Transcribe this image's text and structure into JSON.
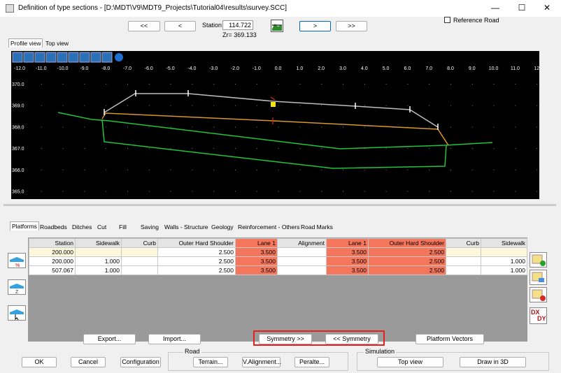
{
  "window": {
    "title": "Definition of type sections - [D:\\MDT\\V9\\MDT9_Projects\\Tutorial04\\results\\survey.SCC]",
    "minimize": "—",
    "maximize": "☐",
    "close": "✕"
  },
  "nav": {
    "first": "<<",
    "prev": "<",
    "next": ">",
    "last": ">>",
    "station_label": "Station",
    "station_value": "114.722",
    "zr": "Zr= 369.133",
    "reference_road": "Reference Road"
  },
  "view_tabs": [
    "Profile view",
    "Top view"
  ],
  "x_ticks": [
    "-12.0",
    "-11.0",
    "-10.0",
    "-9.0",
    "-8.0",
    "-7.0",
    "-6.0",
    "-5.0",
    "-4.0",
    "-3.0",
    "-2.0",
    "-1.0",
    "0.0",
    "1.0",
    "2.0",
    "3.0",
    "4.0",
    "5.0",
    "6.0",
    "7.0",
    "8.0",
    "9.0",
    "10.0",
    "11.0",
    "12"
  ],
  "y_ticks": [
    "370.0",
    "369.0",
    "368.0",
    "367.0",
    "366.0",
    "365.0"
  ],
  "section_tabs": [
    "Platforms",
    "Roadbeds",
    "Ditches",
    "Cut",
    "Fill",
    "Saving",
    "Walls - Structure",
    "Geology",
    "Reinforcement - Others",
    "Road Marks"
  ],
  "table": {
    "headers": [
      "Station",
      "Sidewalk",
      "Curb",
      "Outer Hard Shoulder",
      "Lane 1",
      "Alignment",
      "Lane 1",
      "Outer Hard Shoulder",
      "Curb",
      "Sidewalk"
    ],
    "rows": [
      [
        "200.000",
        "",
        "",
        "2.500",
        "3.500",
        "",
        "3.500",
        "2.500",
        "",
        ""
      ],
      [
        "200.000",
        "1.000",
        "",
        "2.500",
        "3.500",
        "",
        "3.500",
        "2.500",
        "",
        "1.000"
      ],
      [
        "507.067",
        "1.000",
        "",
        "2.500",
        "3.500",
        "",
        "3.500",
        "2.500",
        "",
        "1.000"
      ]
    ]
  },
  "dxdy": {
    "dx": "DX",
    "dy": "DY"
  },
  "buttons": {
    "export": "Export...",
    "import": "Import...",
    "symmetry_right": "Symmetry >>",
    "symmetry_left": "<< Symmetry",
    "platform_vectors": "Platform Vectors",
    "ok": "OK",
    "cancel": "Cancel",
    "configuration": "Configuration",
    "terrain": "Terrain...",
    "valignment": "V.Alignment...",
    "peralte": "Peralte...",
    "top_view": "Top view",
    "draw3d": "Draw in 3D"
  },
  "groups": {
    "road": "Road",
    "simulation": "Simulation"
  },
  "colors": {
    "canvas_bg": "#000000",
    "highlight_cell": "#f4765d",
    "cream_cell": "#fdf8dc",
    "terrain": "#22c43a",
    "platform": "#d9962a",
    "profile_top": "#bdbdbd",
    "symmetry_box": "#e0231c"
  }
}
